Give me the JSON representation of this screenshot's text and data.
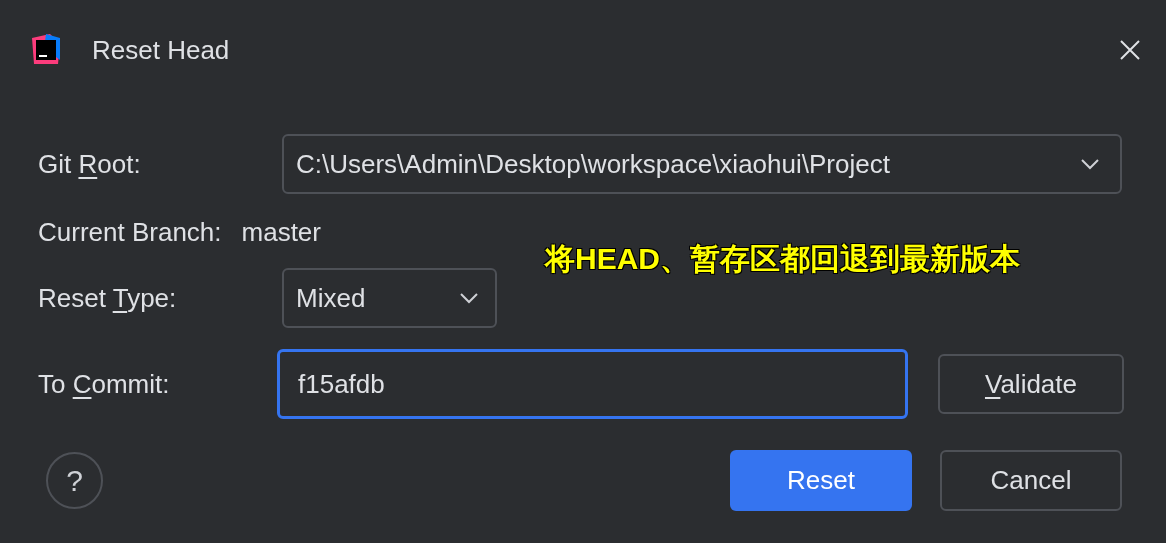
{
  "window": {
    "title": "Reset Head"
  },
  "git_root": {
    "label": {
      "before": "Git ",
      "key": "R",
      "after": "oot:"
    },
    "value": "C:\\Users\\Admin\\Desktop\\workspace\\xiaohui\\Project"
  },
  "current_branch": {
    "label": "Current Branch:",
    "value": "master"
  },
  "annotation": "将HEAD、暂存区都回退到最新版本",
  "reset_type": {
    "label": {
      "before": "Reset ",
      "key": "T",
      "after": "ype:"
    },
    "value": "Mixed"
  },
  "to_commit": {
    "label": {
      "before": "To ",
      "key": "C",
      "after": "ommit:"
    },
    "value": "f15afdb",
    "focused": true
  },
  "validate_button": {
    "key": "V",
    "after": "alidate"
  },
  "help": "?",
  "buttons": [
    {
      "label": "Reset",
      "kind": "primary"
    },
    {
      "label": "Cancel",
      "kind": "secondary"
    }
  ]
}
